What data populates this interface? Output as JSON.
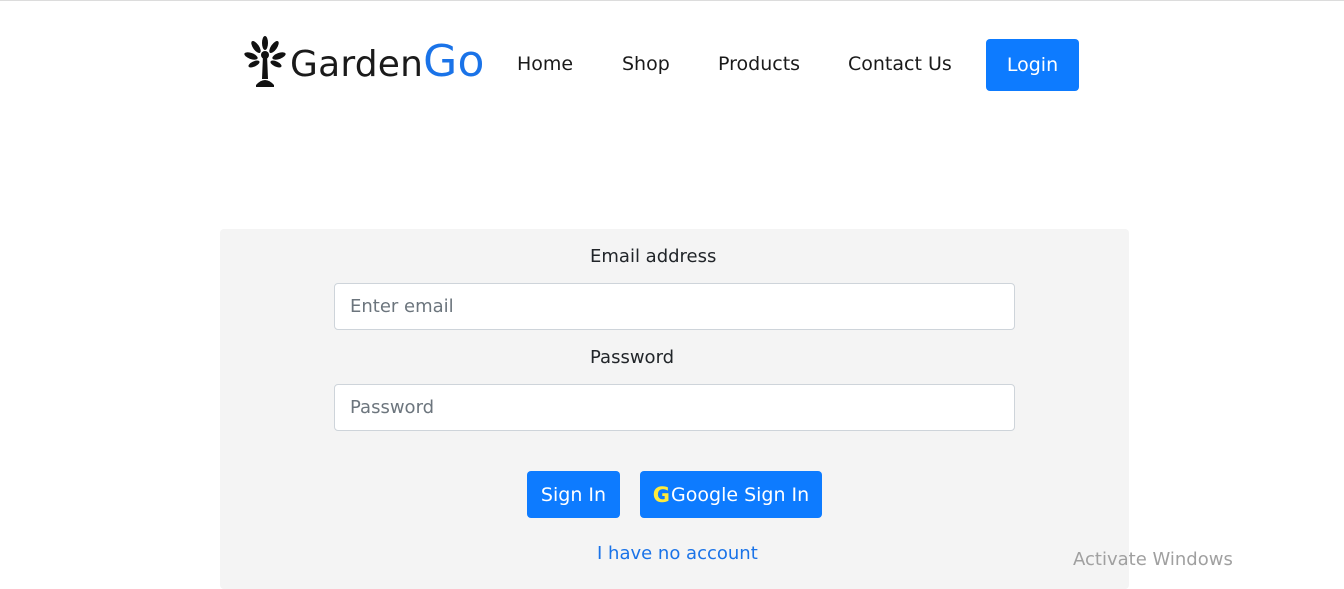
{
  "header": {
    "brand": {
      "part1": "Garden",
      "part2": "Go",
      "icon": "tree-icon"
    },
    "nav": [
      {
        "label": "Home"
      },
      {
        "label": "Shop"
      },
      {
        "label": "Products"
      },
      {
        "label": "Contact Us"
      }
    ],
    "login_label": "Login"
  },
  "form": {
    "email_label": "Email address",
    "email_placeholder": "Enter email",
    "email_value": "",
    "password_label": "Password",
    "password_placeholder": "Password",
    "password_value": "",
    "signin_label": "Sign In",
    "google_g": "G",
    "google_label": "Google Sign In",
    "no_account_label": "I have no account"
  },
  "watermark": "Activate Windows",
  "colors": {
    "primary": "#0d7bff",
    "brand_accent": "#1a73e8",
    "panel_bg": "#f4f4f4",
    "google_g": "#ffeb3b"
  }
}
